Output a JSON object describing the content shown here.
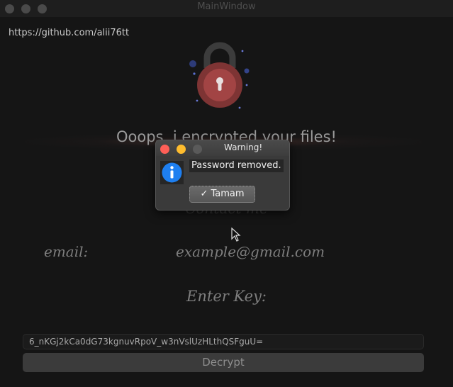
{
  "window": {
    "title": "MainWindow"
  },
  "header": {
    "github_link": "https://github.com/alii76tt",
    "headline": "Ooops, i encrypted your files!",
    "contact_label": "Contact me"
  },
  "contact": {
    "email_label": "email:",
    "email_value": "example@gmail.com"
  },
  "key": {
    "label": "Enter Key:",
    "value": "6_nKGj2kCa0dG73kgnuvRpoV_w3nVslUzHLthQSFguU="
  },
  "decrypt_button": {
    "label": "Decrypt"
  },
  "dialog": {
    "title": "Warning!",
    "message": "Password removed.",
    "ok_label": "✓ Tamam",
    "icon": "info-icon",
    "buttons_colors": {
      "close": "#ff5f57",
      "minimize": "#febc2e",
      "zoom": "#5a5a5a"
    }
  },
  "colors": {
    "lock_body": "#8a3a3a",
    "lock_accent": "#3a4a8a",
    "info_blue": "#1e7ff0"
  }
}
